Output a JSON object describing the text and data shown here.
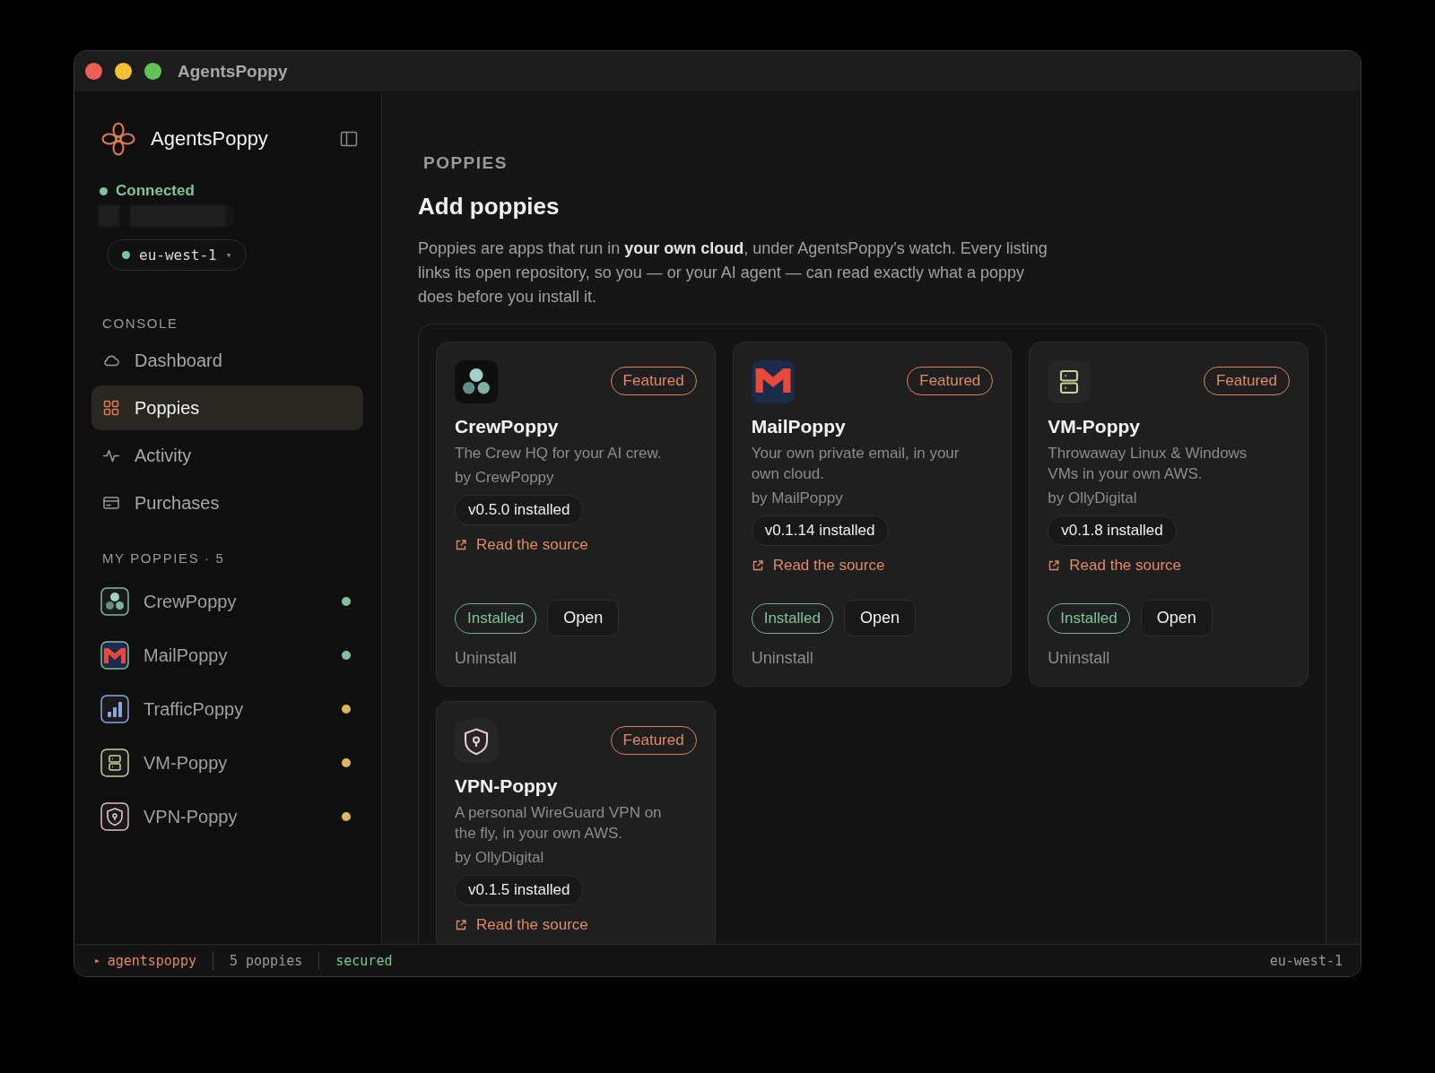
{
  "window": {
    "title": "AgentsPoppy"
  },
  "sidebar": {
    "brand": "AgentsPoppy",
    "connection": "Connected",
    "region": "eu-west-1",
    "region_caret": "▾",
    "console_heading": "CONSOLE",
    "nav": [
      {
        "label": "Dashboard",
        "kind": "dashboard",
        "selected": false
      },
      {
        "label": "Poppies",
        "kind": "poppies",
        "selected": true
      },
      {
        "label": "Activity",
        "kind": "activity",
        "selected": false
      },
      {
        "label": "Purchases",
        "kind": "purchases",
        "selected": false
      }
    ],
    "my_poppies": {
      "heading": "MY POPPIES · 5",
      "items": [
        {
          "name": "CrewPoppy",
          "kind": "crew",
          "color": "#7fc59c"
        },
        {
          "name": "MailPoppy",
          "kind": "mail",
          "color": "#7fc59c"
        },
        {
          "name": "TrafficPoppy",
          "kind": "traffic",
          "color": "#e3b55a"
        },
        {
          "name": "VM-Poppy",
          "kind": "vm",
          "color": "#e3b55a"
        },
        {
          "name": "VPN-Poppy",
          "kind": "vpn",
          "color": "#e3b55a"
        }
      ]
    }
  },
  "main": {
    "eyebrow": "POPPIES",
    "title": "Add poppies",
    "intro": "Poppies are apps that run in **your own cloud**, under AgentsPoppy's watch. Every listing links its open repository, so you — or your AI agent — can read exactly what a poppy does before you install it.",
    "cards": [
      {
        "name": "CrewPoppy",
        "kind": "crew",
        "badge": "Featured",
        "description": "The Crew HQ for your AI crew.",
        "author": "by CrewPoppy",
        "version": "v0.5.0 installed",
        "link": "Read the source",
        "status": "Installed",
        "open": "Open",
        "uninstall": "Uninstall"
      },
      {
        "name": "MailPoppy",
        "kind": "mail",
        "badge": "Featured",
        "description": "Your own private email, in your own cloud.",
        "author": "by MailPoppy",
        "version": "v0.1.14 installed",
        "link": "Read the source",
        "status": "Installed",
        "open": "Open",
        "uninstall": "Uninstall"
      },
      {
        "name": "VM-Poppy",
        "kind": "vm",
        "badge": "Featured",
        "description": "Throwaway Linux & Windows VMs in your own AWS.",
        "author": "by OllyDigital",
        "version": "v0.1.8 installed",
        "link": "Read the source",
        "status": "Installed",
        "open": "Open",
        "uninstall": "Uninstall"
      },
      {
        "name": "VPN-Poppy",
        "kind": "vpn",
        "badge": "Featured",
        "description": "A personal WireGuard VPN on the fly, in your own AWS.",
        "author": "by OllyDigital",
        "version": "v0.1.5 installed",
        "link": "Read the source"
      }
    ]
  },
  "status_bar": {
    "prompt": "▸",
    "user": "agentspoppy",
    "count": "5 poppies",
    "security": "secured",
    "region": "eu-west-1"
  }
}
